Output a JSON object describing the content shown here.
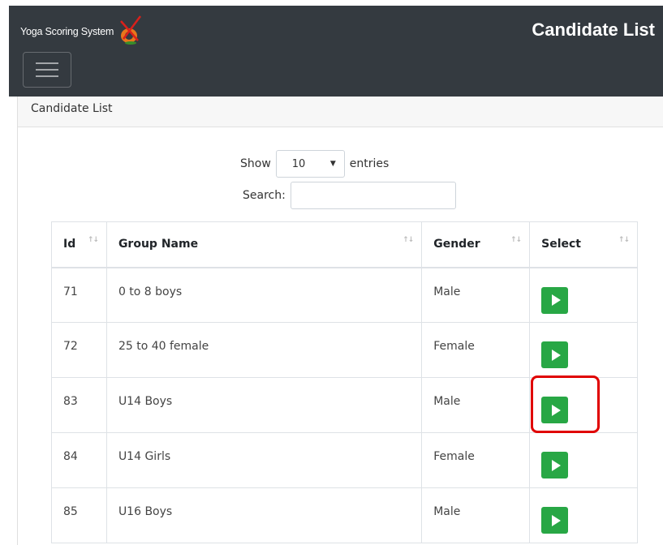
{
  "navbar": {
    "brand": "Yoga Scoring System",
    "page_heading": "Candidate List",
    "logo_icon": "yoga-logo-icon",
    "toggle_icon": "hamburger-icon"
  },
  "card": {
    "header": "Candidate List"
  },
  "length_control": {
    "show_label": "Show",
    "selected": "10",
    "entries_label": "entries"
  },
  "search": {
    "label": "Search:",
    "value": ""
  },
  "table": {
    "columns": [
      "Id",
      "Group Name",
      "Gender",
      "Select"
    ],
    "rows": [
      {
        "id": "71",
        "group": "0 to 8 boys",
        "gender": "Male"
      },
      {
        "id": "72",
        "group": "25 to 40 female",
        "gender": "Female"
      },
      {
        "id": "83",
        "group": "U14 Boys",
        "gender": "Male"
      },
      {
        "id": "84",
        "group": "U14 Girls",
        "gender": "Female"
      },
      {
        "id": "85",
        "group": "U16 Boys",
        "gender": "Male"
      }
    ]
  },
  "colors": {
    "navbar": "#343a40",
    "select_button": "#28a745",
    "highlight": "#e00000"
  }
}
